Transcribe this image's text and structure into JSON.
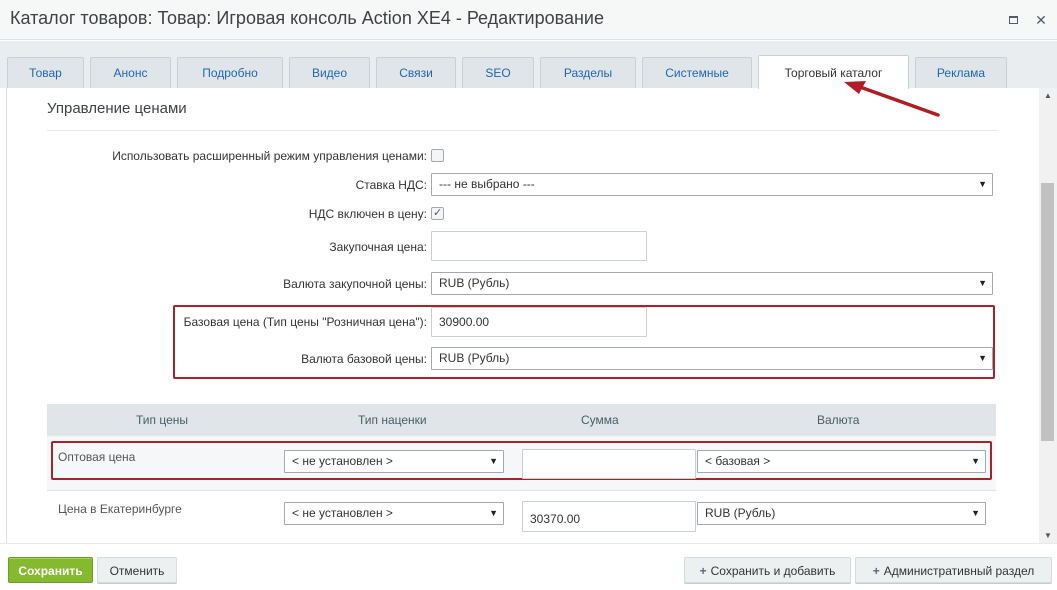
{
  "window": {
    "title": "Каталог товаров: Товар: Игровая консоль Action XE4 - Редактирование"
  },
  "tabs": [
    {
      "label": "Товар"
    },
    {
      "label": "Анонс"
    },
    {
      "label": "Подробно"
    },
    {
      "label": "Видео"
    },
    {
      "label": "Связи"
    },
    {
      "label": "SEO"
    },
    {
      "label": "Разделы"
    },
    {
      "label": "Системные"
    },
    {
      "label": "Торговый каталог",
      "active": true
    },
    {
      "label": "Реклама"
    }
  ],
  "section": {
    "title": "Управление ценами"
  },
  "form": {
    "extended_mode_label": "Использовать расширенный режим управления ценами:",
    "extended_mode_checked": false,
    "vat_rate_label": "Ставка НДС:",
    "vat_rate_value": "--- не выбрано ---",
    "vat_included_label": "НДС включен в цену:",
    "vat_included_checked": true,
    "purchase_price_label": "Закупочная цена:",
    "purchase_price_value": "",
    "purchase_currency_label": "Валюта закупочной цены:",
    "purchase_currency_value": "RUB (Рубль)",
    "base_price_label": "Базовая цена (Тип цены \"Розничная цена\"):",
    "base_price_value": "30900.00",
    "base_currency_label": "Валюта базовой цены:",
    "base_currency_value": "RUB (Рубль)"
  },
  "price_table": {
    "headers": [
      "Тип цены",
      "Тип наценки",
      "Сумма",
      "Валюта"
    ],
    "rows": [
      {
        "type": "Оптовая цена",
        "markup": "< не установлен >",
        "sum": "",
        "currency": "< базовая >"
      },
      {
        "type": "Цена в Екатеринбурге",
        "markup": "< не установлен >",
        "sum": "30370.00",
        "currency": "RUB (Рубль)"
      }
    ]
  },
  "footer": {
    "save": "Сохранить",
    "cancel": "Отменить",
    "save_add": "Сохранить и добавить",
    "admin": "Административный раздел"
  },
  "colors": {
    "accent_green": "#85b92e",
    "highlight_red": "#a3242a",
    "link_blue": "#2067b0"
  },
  "icons": {
    "checkmark": "check-icon",
    "dropdown": "chevron-down-icon",
    "plus": "plus-icon"
  }
}
